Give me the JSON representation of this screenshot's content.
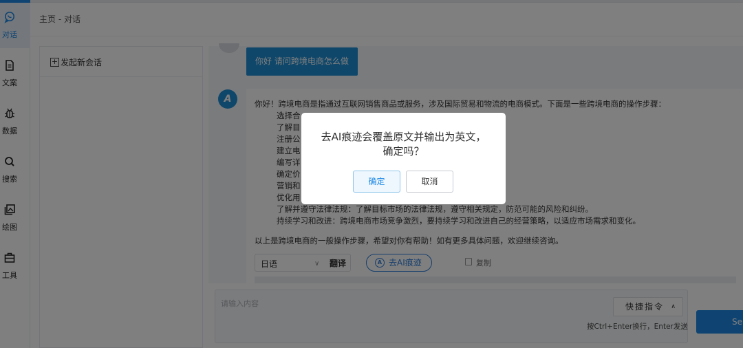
{
  "nav": {
    "items": [
      {
        "label": "对话",
        "icon": "chat-bubble-icon",
        "active": true
      },
      {
        "label": "文案",
        "icon": "document-icon"
      },
      {
        "label": "数据",
        "icon": "bug-icon"
      },
      {
        "label": "搜索",
        "icon": "search-icon"
      },
      {
        "label": "绘图",
        "icon": "image-icon"
      },
      {
        "label": "工具",
        "icon": "toolbox-icon"
      }
    ]
  },
  "breadcrumb": "主页 - 对话",
  "conversations": {
    "new_chat_label": "发起新会话"
  },
  "chat": {
    "question": "你好 请问跨境电商怎么做",
    "bot_avatar_text": "A",
    "answer_intro": "你好！跨境电商是指通过互联网销售商品或服务，涉及国际贸易和物流的电商模式。下面是一些跨境电商的操作步骤：",
    "answer_steps": [
      "选择合",
      "了解目",
      "注册公",
      "建立电",
      "编写详",
      "确定价",
      "营销和",
      "优化用",
      "了解并遵守法律法规：了解目标市场的法律法规，遵守相关规定，防范可能的风险和纠纷。",
      "持续学习和改进：跨境电商市场竞争激烈，要持续学习和改进自己的经营策略，以适应市场需求和变化。"
    ],
    "answer_outro": "以上是跨境电商的一般操作步骤，希望对你有帮助！如有更多具体问题，欢迎继续咨询。",
    "lang_value": "日语",
    "translate_label": "翻译",
    "deai_label": "去AI痕迹",
    "copy_label": "复制"
  },
  "input": {
    "placeholder": "请输入内容",
    "quick_cmd_label": "快捷指令",
    "hint": "按Ctrl+Enter换行，Enter发送",
    "send_label": "Send"
  },
  "dialog": {
    "message_line1": "去AI痕迹会覆盖原文并输出为英文，",
    "message_line2": "确定吗？",
    "ok_label": "确定",
    "cancel_label": "取消"
  },
  "colors": {
    "primary": "#1e88e5",
    "bubble": "#1f8ed4",
    "overlay": "rgba(0,0,0,0.5)"
  }
}
